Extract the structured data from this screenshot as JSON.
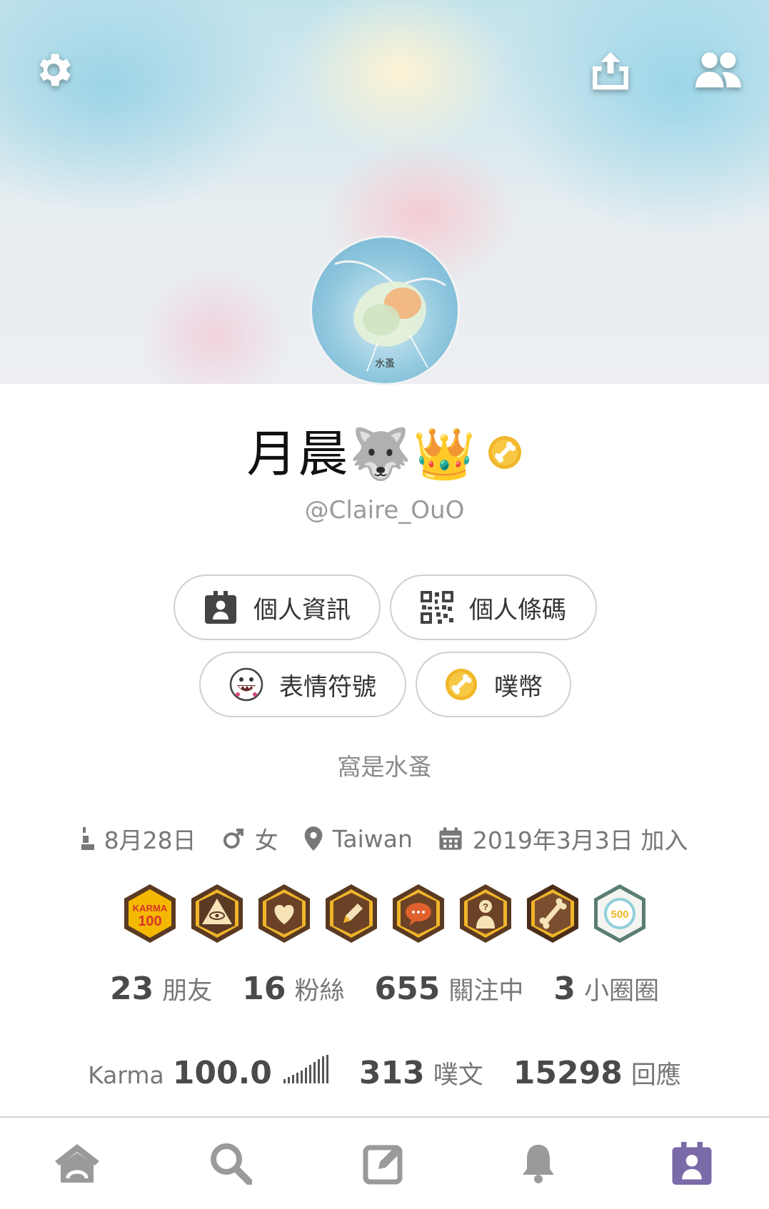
{
  "header": {
    "settings_icon": "gear-icon",
    "share_icon": "upload-icon",
    "friends_icon": "people-icon",
    "avatar_caption": "水蚤"
  },
  "profile": {
    "display_name": "月晨🐺👑",
    "handle": "@Claire_OuO",
    "bio": "窩是水蚤"
  },
  "actions": [
    {
      "label": "個人資訊",
      "icon": "id-card-icon"
    },
    {
      "label": "個人條碼",
      "icon": "qr-code-icon"
    },
    {
      "label": "表情符號",
      "icon": "emoticon-icon"
    },
    {
      "label": "噗幣",
      "icon": "coin-icon"
    }
  ],
  "meta": {
    "birthday": "8月28日",
    "gender": "女",
    "location": "Taiwan",
    "joined": "2019年3月3日 加入"
  },
  "badges": [
    "karma-100-badge",
    "illuminati-eye-badge",
    "heart-badge",
    "pencil-badge",
    "speech-bubble-badge",
    "question-person-badge",
    "bone-badge",
    "500-badge"
  ],
  "badge_text": {
    "karma_top": "KARMA",
    "karma_bottom": "100",
    "five_hundred": "500"
  },
  "stats": {
    "friends_count": "23",
    "friends_label": "朋友",
    "fans_count": "16",
    "fans_label": "粉絲",
    "following_count": "655",
    "following_label": "關注中",
    "cliques_count": "3",
    "cliques_label": "小圈圈"
  },
  "karma": {
    "label": "Karma",
    "value": "100.0",
    "plurks_count": "313",
    "plurks_label": "噗文",
    "responses_count": "15298",
    "responses_label": "回應"
  },
  "tabbar": {
    "active_color": "#7a6aa8",
    "icons": [
      "home-icon",
      "search-icon",
      "compose-icon",
      "bell-icon",
      "profile-card-icon"
    ]
  }
}
